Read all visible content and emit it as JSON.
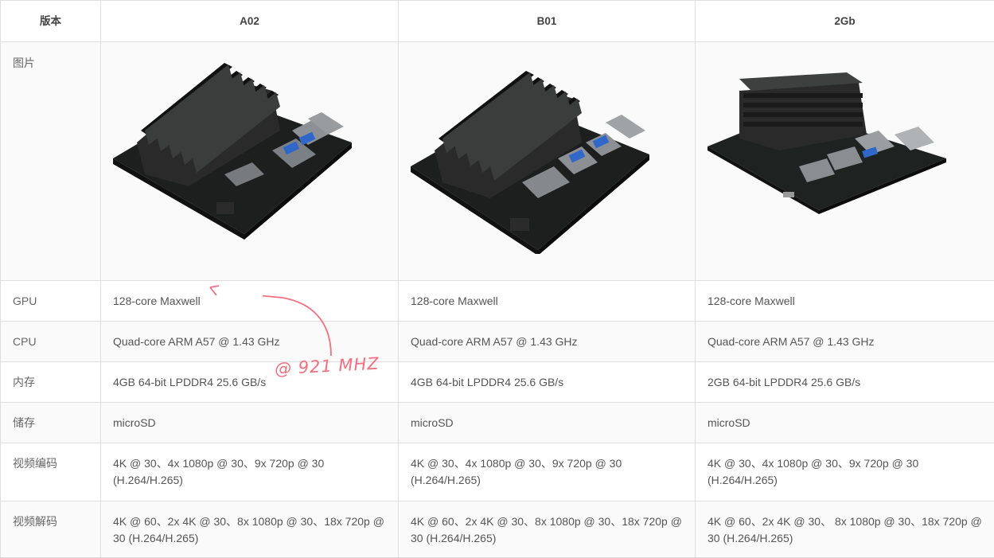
{
  "header": {
    "label": "版本",
    "versions": [
      "A02",
      "B01",
      "2Gb"
    ]
  },
  "rows": [
    {
      "label": "图片",
      "cells": [
        "",
        "",
        ""
      ]
    },
    {
      "label": "GPU",
      "cells": [
        "128-core Maxwell",
        "128-core Maxwell",
        "128-core Maxwell"
      ]
    },
    {
      "label": "CPU",
      "cells": [
        "Quad-core ARM A57 @ 1.43 GHz",
        "Quad-core ARM A57 @ 1.43 GHz",
        "Quad-core ARM A57 @ 1.43 GHz"
      ]
    },
    {
      "label": "内存",
      "cells": [
        "4GB 64-bit LPDDR4 25.6 GB/s",
        "4GB 64-bit LPDDR4 25.6 GB/s",
        "2GB 64-bit LPDDR4 25.6 GB/s"
      ]
    },
    {
      "label": "储存",
      "cells": [
        "microSD",
        "microSD",
        "microSD"
      ]
    },
    {
      "label": "视频编码",
      "cells": [
        "4K @ 30、4x 1080p @ 30、9x 720p @ 30 (H.264/H.265)",
        "4K @ 30、4x 1080p @ 30、9x 720p @ 30 (H.264/H.265)",
        "4K @ 30、4x 1080p @ 30、9x 720p @ 30 (H.264/H.265)"
      ]
    },
    {
      "label": "视频解码",
      "cells": [
        "4K @ 60、2x 4K @ 30、8x 1080p @ 30、18x 720p @ 30 (H.264/H.265)",
        "4K @ 60、2x 4K @ 30、8x 1080p @ 30、18x 720p @ 30 (H.264/H.265)",
        "4K @ 60、2x 4K @ 30、 8x 1080p @ 30、18x 720p @ 30 (H.264/H.265)"
      ]
    }
  ],
  "annotation": {
    "text": "@ 921 MHZ",
    "color": "#f46f7f"
  }
}
